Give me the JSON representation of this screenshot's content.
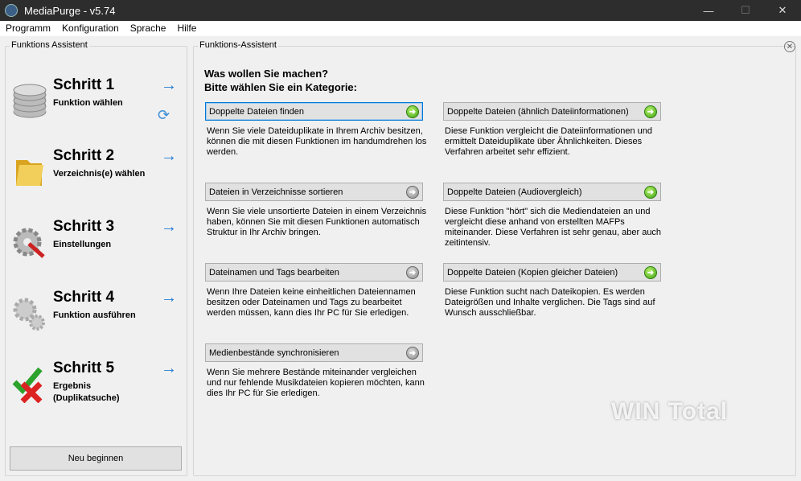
{
  "window": {
    "title": "MediaPurge - v5.74",
    "minimize": "—",
    "maximize": "☐",
    "close": "✕"
  },
  "menu": [
    "Programm",
    "Konfiguration",
    "Sprache",
    "Hilfe"
  ],
  "left": {
    "group_label": "Funktions Assistent",
    "steps": [
      {
        "title": "Schritt 1",
        "subtitle": "Funktion wählen"
      },
      {
        "title": "Schritt 2",
        "subtitle": "Verzeichnis(e) wählen"
      },
      {
        "title": "Schritt 3",
        "subtitle": "Einstellungen"
      },
      {
        "title": "Schritt 4",
        "subtitle": "Funktion ausführen"
      },
      {
        "title": "Schritt 5",
        "subtitle": "Ergebnis (Duplikatsuche)"
      }
    ],
    "arrow": "→",
    "restart": "Neu beginnen"
  },
  "right": {
    "group_label": "Funktions-Assistent",
    "close": "✕",
    "heading1": "Was wollen Sie machen?",
    "heading2": "Bitte wählen Sie ein Kategorie:",
    "functions": [
      {
        "label": "Doppelte Dateien finden",
        "desc": "Wenn Sie viele Dateiduplikate in Ihrem Archiv besitzen, können die mit diesen Funktionen im handumdrehen los werden.",
        "status": "green"
      },
      {
        "label": "Doppelte Dateien (ähnlich Dateiinformationen)",
        "desc": "Diese Funktion vergleicht die Dateiinformationen und ermittelt Dateiduplikate über Ähnlichkeiten.  Dieses Verfahren arbeitet sehr effizient.",
        "status": "green"
      },
      {
        "label": "Dateien in Verzeichnisse sortieren",
        "desc": "Wenn Sie viele unsortierte Dateien in einem Verzeichnis haben, können Sie mit diesen Funktionen automatisch Struktur in Ihr Archiv bringen.",
        "status": "gray"
      },
      {
        "label": "Doppelte Dateien (Audiovergleich)",
        "desc": "Diese Funktion \"hört\" sich die Mediendateien an und vergleicht diese anhand von erstellten MAFPs miteinander.  Diese Verfahren ist sehr genau, aber auch zeitintensiv.",
        "status": "green"
      },
      {
        "label": "Dateinamen und Tags bearbeiten",
        "desc": "Wenn Ihre Dateien keine einheitlichen Dateiennamen besitzen oder Dateinamen und Tags zu bearbeitet werden müssen,  kann dies Ihr PC für Sie erledigen.",
        "status": "gray"
      },
      {
        "label": "Doppelte Dateien (Kopien gleicher Dateien)",
        "desc": "Diese Funktion sucht nach Dateikopien.  Es werden Dateigrößen und Inhalte verglichen. Die Tags sind auf Wunsch ausschließbar.",
        "status": "green"
      },
      {
        "label": "Medienbestände synchronisieren",
        "desc": "Wenn Sie mehrere Bestände miteinander vergleichen und nur fehlende Musikdateien kopieren möchten, kann dies Ihr PC für Sie erledigen.",
        "status": "gray"
      }
    ]
  },
  "watermark": "WIN Total"
}
